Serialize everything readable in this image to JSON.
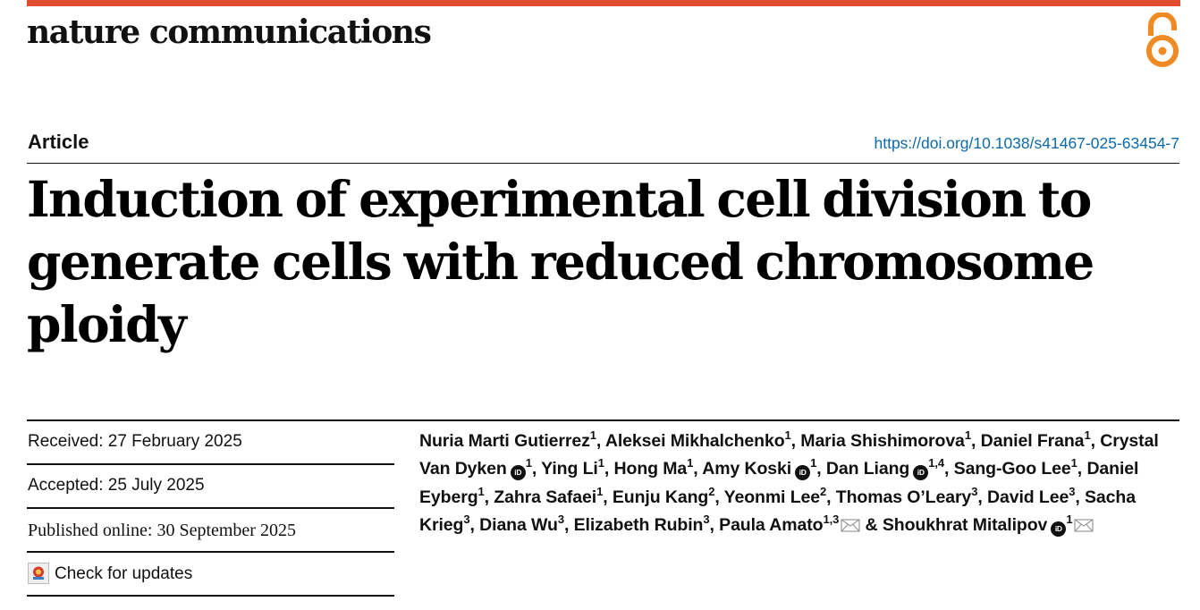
{
  "journal": {
    "name": "nature communications"
  },
  "article": {
    "type": "Article",
    "doi": "https://doi.org/10.1038/s41467-025-63454-7",
    "title": "Induction of experimental cell division to generate cells with reduced chromosome ploidy"
  },
  "dates": {
    "received": "Received: 27 February 2025",
    "accepted": "Accepted: 25 July 2025",
    "published": "Published online: 30 September 2025",
    "check_updates": "Check for updates"
  },
  "authors": [
    {
      "name": "Nuria Marti Gutierrez",
      "aff": "1"
    },
    {
      "name": "Aleksei Mikhalchenko",
      "aff": "1"
    },
    {
      "name": "Maria Shishimorova",
      "aff": "1"
    },
    {
      "name": "Daniel Frana",
      "aff": "1"
    },
    {
      "name": "Crystal Van Dyken",
      "aff": "1",
      "orcid": true
    },
    {
      "name": "Ying Li",
      "aff": "1"
    },
    {
      "name": "Hong Ma",
      "aff": "1"
    },
    {
      "name": "Amy Koski",
      "aff": "1",
      "orcid": true
    },
    {
      "name": "Dan Liang",
      "aff": "1,4",
      "orcid": true
    },
    {
      "name": "Sang-Goo Lee",
      "aff": "1"
    },
    {
      "name": "Daniel Eyberg",
      "aff": "1"
    },
    {
      "name": "Zahra Safaei",
      "aff": "1"
    },
    {
      "name": "Eunju Kang",
      "aff": "2"
    },
    {
      "name": "Yeonmi Lee",
      "aff": "2"
    },
    {
      "name": "Thomas O’Leary",
      "aff": "3"
    },
    {
      "name": "David Lee",
      "aff": "3"
    },
    {
      "name": "Sacha Krieg",
      "aff": "3"
    },
    {
      "name": "Diana Wu",
      "aff": "3"
    },
    {
      "name": "Elizabeth Rubin",
      "aff": "3"
    },
    {
      "name": "Paula Amato",
      "aff": "1,3",
      "email": true
    },
    {
      "name": "Shoukhrat Mitalipov",
      "aff": "1",
      "orcid": true,
      "email": true
    }
  ],
  "icons": {
    "open_access": "open-access-icon",
    "orcid": "orcid-icon",
    "email": "envelope-icon",
    "updates": "crossmark-icon"
  },
  "colors": {
    "brand_bar": "#e04a2f",
    "open_access": "#f08a24",
    "link": "#0d6aa8"
  }
}
